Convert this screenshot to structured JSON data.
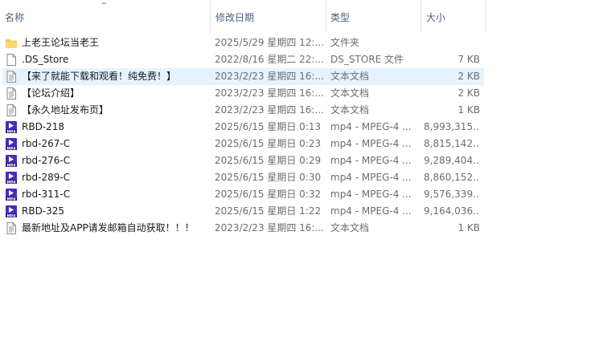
{
  "columns": {
    "name": "名称",
    "date": "修改日期",
    "type": "类型",
    "size": "大小"
  },
  "sort_indicator": "^",
  "files": [
    {
      "name": "上老王论坛当老王",
      "date": "2025/5/29 星期四 12:...",
      "type": "文件夹",
      "size": "",
      "icon": "folder-icon"
    },
    {
      "name": ".DS_Store",
      "date": "2022/8/16 星期二 22:...",
      "type": "DS_STORE 文件",
      "size": "7 KB",
      "icon": "blank-file-icon"
    },
    {
      "name": "【来了就能下载和观看！纯免费！】",
      "date": "2023/2/23 星期四 16:...",
      "type": "文本文档",
      "size": "2 KB",
      "icon": "text-file-icon",
      "selected": true
    },
    {
      "name": "【论坛介绍】",
      "date": "2023/2/23 星期四 16:...",
      "type": "文本文档",
      "size": "2 KB",
      "icon": "text-file-icon"
    },
    {
      "name": "【永久地址发布页】",
      "date": "2023/2/23 星期四 16:...",
      "type": "文本文档",
      "size": "1 KB",
      "icon": "text-file-icon"
    },
    {
      "name": "RBD-218",
      "date": "2025/6/15 星期日 0:13",
      "type": "mp4 - MPEG-4 ...",
      "size": "8,993,315...",
      "icon": "mp4-video-icon"
    },
    {
      "name": "rbd-267-C",
      "date": "2025/6/15 星期日 0:23",
      "type": "mp4 - MPEG-4 ...",
      "size": "8,815,142...",
      "icon": "mp4-video-icon"
    },
    {
      "name": "rbd-276-C",
      "date": "2025/6/15 星期日 0:29",
      "type": "mp4 - MPEG-4 ...",
      "size": "9,289,404...",
      "icon": "mp4-video-icon"
    },
    {
      "name": "rbd-289-C",
      "date": "2025/6/15 星期日 0:30",
      "type": "mp4 - MPEG-4 ...",
      "size": "8,860,152...",
      "icon": "mp4-video-icon"
    },
    {
      "name": "rbd-311-C",
      "date": "2025/6/15 星期日 0:32",
      "type": "mp4 - MPEG-4 ...",
      "size": "9,576,339...",
      "icon": "mp4-video-icon"
    },
    {
      "name": "RBD-325",
      "date": "2025/6/15 星期日 1:22",
      "type": "mp4 - MPEG-4 ...",
      "size": "9,164,036...",
      "icon": "mp4-video-icon"
    },
    {
      "name": "最新地址及APP请发邮箱自动获取！！！",
      "date": "2023/2/23 星期四 16:...",
      "type": "文本文档",
      "size": "1 KB",
      "icon": "text-file-icon"
    }
  ],
  "colors": {
    "header_text": "#4c607a",
    "selected_bg": "#e5f3ff",
    "folder": "#f8d775",
    "mp4_icon": "#5b2fc9"
  }
}
